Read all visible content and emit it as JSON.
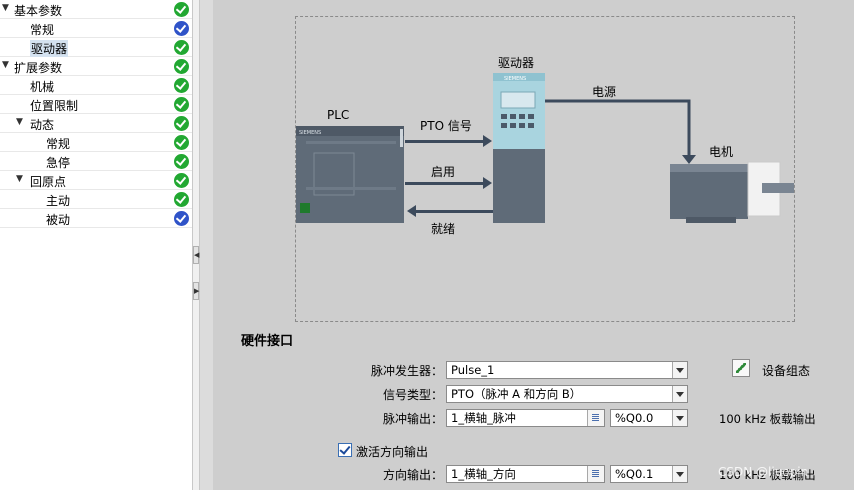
{
  "nav": {
    "items": [
      {
        "label": "基本参数",
        "level": 0,
        "expanded": true,
        "status": "ok"
      },
      {
        "label": "常规",
        "level": 1,
        "status": "info"
      },
      {
        "label": "驱动器",
        "level": 1,
        "status": "ok",
        "selected": true
      },
      {
        "label": "扩展参数",
        "level": 0,
        "expanded": true,
        "status": "ok"
      },
      {
        "label": "机械",
        "level": 1,
        "status": "ok"
      },
      {
        "label": "位置限制",
        "level": 1,
        "status": "ok"
      },
      {
        "label": "动态",
        "level": 1,
        "expanded": true,
        "status": "ok"
      },
      {
        "label": "常规",
        "level": 2,
        "status": "ok"
      },
      {
        "label": "急停",
        "level": 2,
        "status": "ok"
      },
      {
        "label": "回原点",
        "level": 1,
        "expanded": true,
        "status": "ok"
      },
      {
        "label": "主动",
        "level": 2,
        "status": "ok"
      },
      {
        "label": "被动",
        "level": 2,
        "status": "info"
      }
    ]
  },
  "diagram": {
    "plc_label": "PLC",
    "drive_label": "驱动器",
    "motor_label": "电机",
    "pto_signal_label": "PTO 信号",
    "enable_label": "启用",
    "ready_label": "就绪",
    "power_label": "电源",
    "plc_brand": "SIEMENS",
    "drive_brand": "SIEMENS"
  },
  "section": {
    "title": "硬件接口"
  },
  "form": {
    "pulse_generator_label": "脉冲发生器：",
    "pulse_generator_value": "Pulse_1",
    "signal_type_label": "信号类型：",
    "signal_type_value": "PTO（脉冲 A 和方向 B）",
    "pulse_output_label": "脉冲输出：",
    "pulse_output_tag": "1_横轴_脉冲",
    "pulse_output_address": "%Q0.0",
    "pulse_output_note": "100 kHz 板载输出",
    "device_config_label": "设备组态",
    "enable_direction_label": "激活方向输出",
    "enable_direction_checked": true,
    "direction_output_label": "方向输出：",
    "direction_output_tag": "1_横轴_方向",
    "direction_output_address": "%Q0.1",
    "direction_output_note": "100 kHz 板载输出"
  },
  "watermark": "CSDN @liuopin",
  "colors": {
    "ok": "#22a832",
    "info": "#2f53c8",
    "arrow": "#3c4a5c"
  }
}
